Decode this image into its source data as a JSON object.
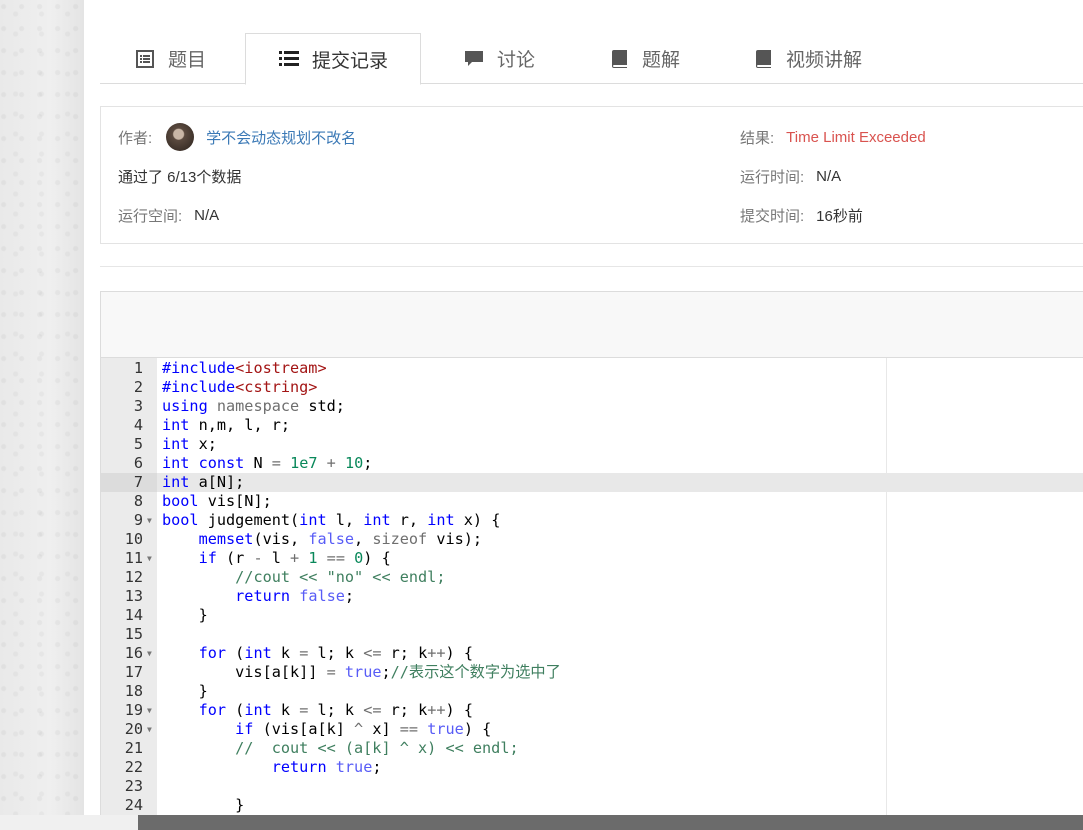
{
  "tabs": [
    {
      "label": "题目",
      "icon": "list-doc-icon"
    },
    {
      "label": "提交记录",
      "icon": "list-icon"
    },
    {
      "label": "讨论",
      "icon": "comment-icon"
    },
    {
      "label": "题解",
      "icon": "book-icon"
    },
    {
      "label": "视频讲解",
      "icon": "book-icon"
    }
  ],
  "info": {
    "author_label": "作者:",
    "author_name": "学不会动态规划不改名",
    "passed_text": "通过了 6/13个数据",
    "space_label": "运行空间:",
    "space_value": "N/A",
    "result_label": "结果:",
    "result_value": "Time Limit Exceeded",
    "result_color": "#d9534f",
    "time_label": "运行时间:",
    "time_value": "N/A",
    "submit_label": "提交时间:",
    "submit_value": "16秒前"
  },
  "code": {
    "active_line": 7,
    "lines": [
      "#include<iostream>",
      "#include<cstring>",
      "using namespace std;",
      "int n,m, l, r;",
      "int x;",
      "int const N = 1e7 + 10;",
      "int a[N];",
      "bool vis[N];",
      "bool judgement(int l, int r, int x) {",
      "    memset(vis, false, sizeof vis);",
      "    if (r - l + 1 == 0) {",
      "        //cout << \"no\" << endl;",
      "        return false;",
      "    }",
      "",
      "    for (int k = l; k <= r; k++) {",
      "        vis[a[k]] = true;//表示这个数字为选中了",
      "    }",
      "    for (int k = l; k <= r; k++) {",
      "        if (vis[a[k] ^ x] == true) {",
      "        //  cout << (a[k] ^ x) << endl;",
      "            return true;",
      "",
      "        }"
    ],
    "fold_lines": [
      9,
      11,
      16,
      19,
      20
    ]
  }
}
